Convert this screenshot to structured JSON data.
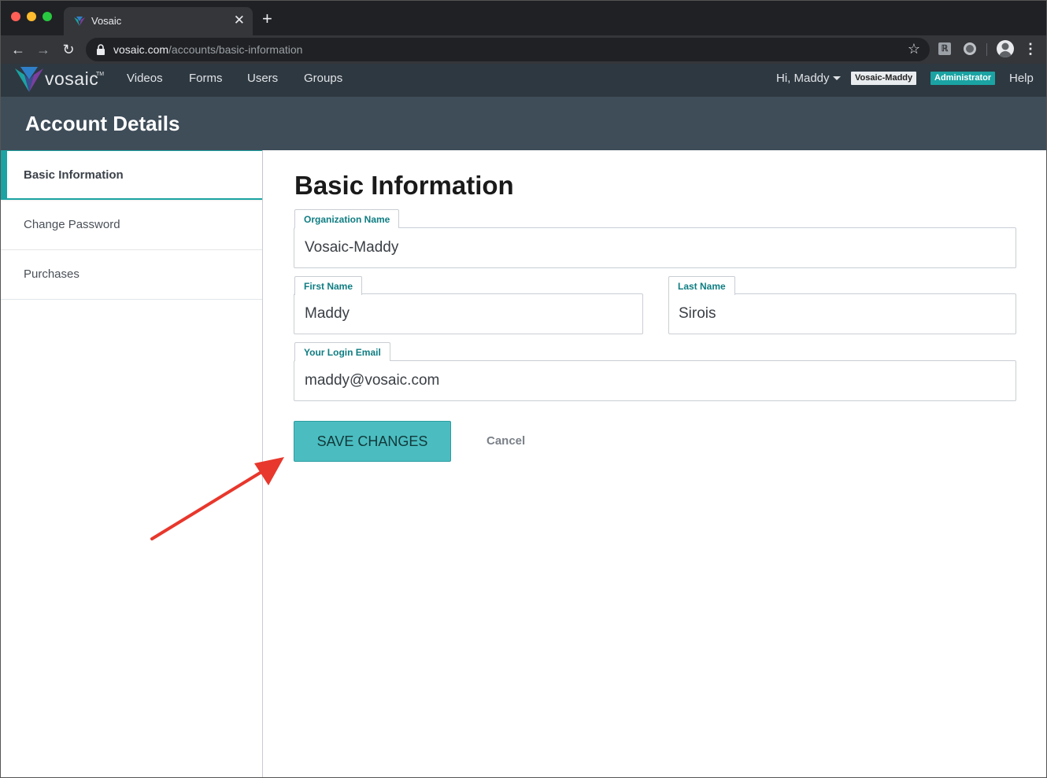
{
  "browser": {
    "tab_title": "Vosaic",
    "url_host": "vosaic.com",
    "url_path": "/accounts/basic-information"
  },
  "app": {
    "logo_text": "vosaic",
    "logo_tm": "TM",
    "nav": [
      "Videos",
      "Forms",
      "Users",
      "Groups"
    ],
    "greeting": "Hi, Maddy",
    "org_badge": "Vosaic-Maddy",
    "role_badge": "Administrator",
    "help": "Help"
  },
  "page": {
    "title": "Account Details"
  },
  "sidebar": {
    "items": [
      {
        "label": "Basic Information",
        "active": true
      },
      {
        "label": "Change Password",
        "active": false
      },
      {
        "label": "Purchases",
        "active": false
      }
    ]
  },
  "form": {
    "title": "Basic Information",
    "organization_name": {
      "label": "Organization Name",
      "value": "Vosaic-Maddy"
    },
    "first_name": {
      "label": "First Name",
      "value": "Maddy"
    },
    "last_name": {
      "label": "Last Name",
      "value": "Sirois"
    },
    "login_email": {
      "label": "Your Login Email",
      "value": "maddy@vosaic.com"
    },
    "save_label": "SAVE CHANGES",
    "cancel_label": "Cancel"
  },
  "colors": {
    "accent": "#1ba3a3",
    "save_button": "#4bbdc0",
    "annotation_arrow": "#e8372c"
  }
}
